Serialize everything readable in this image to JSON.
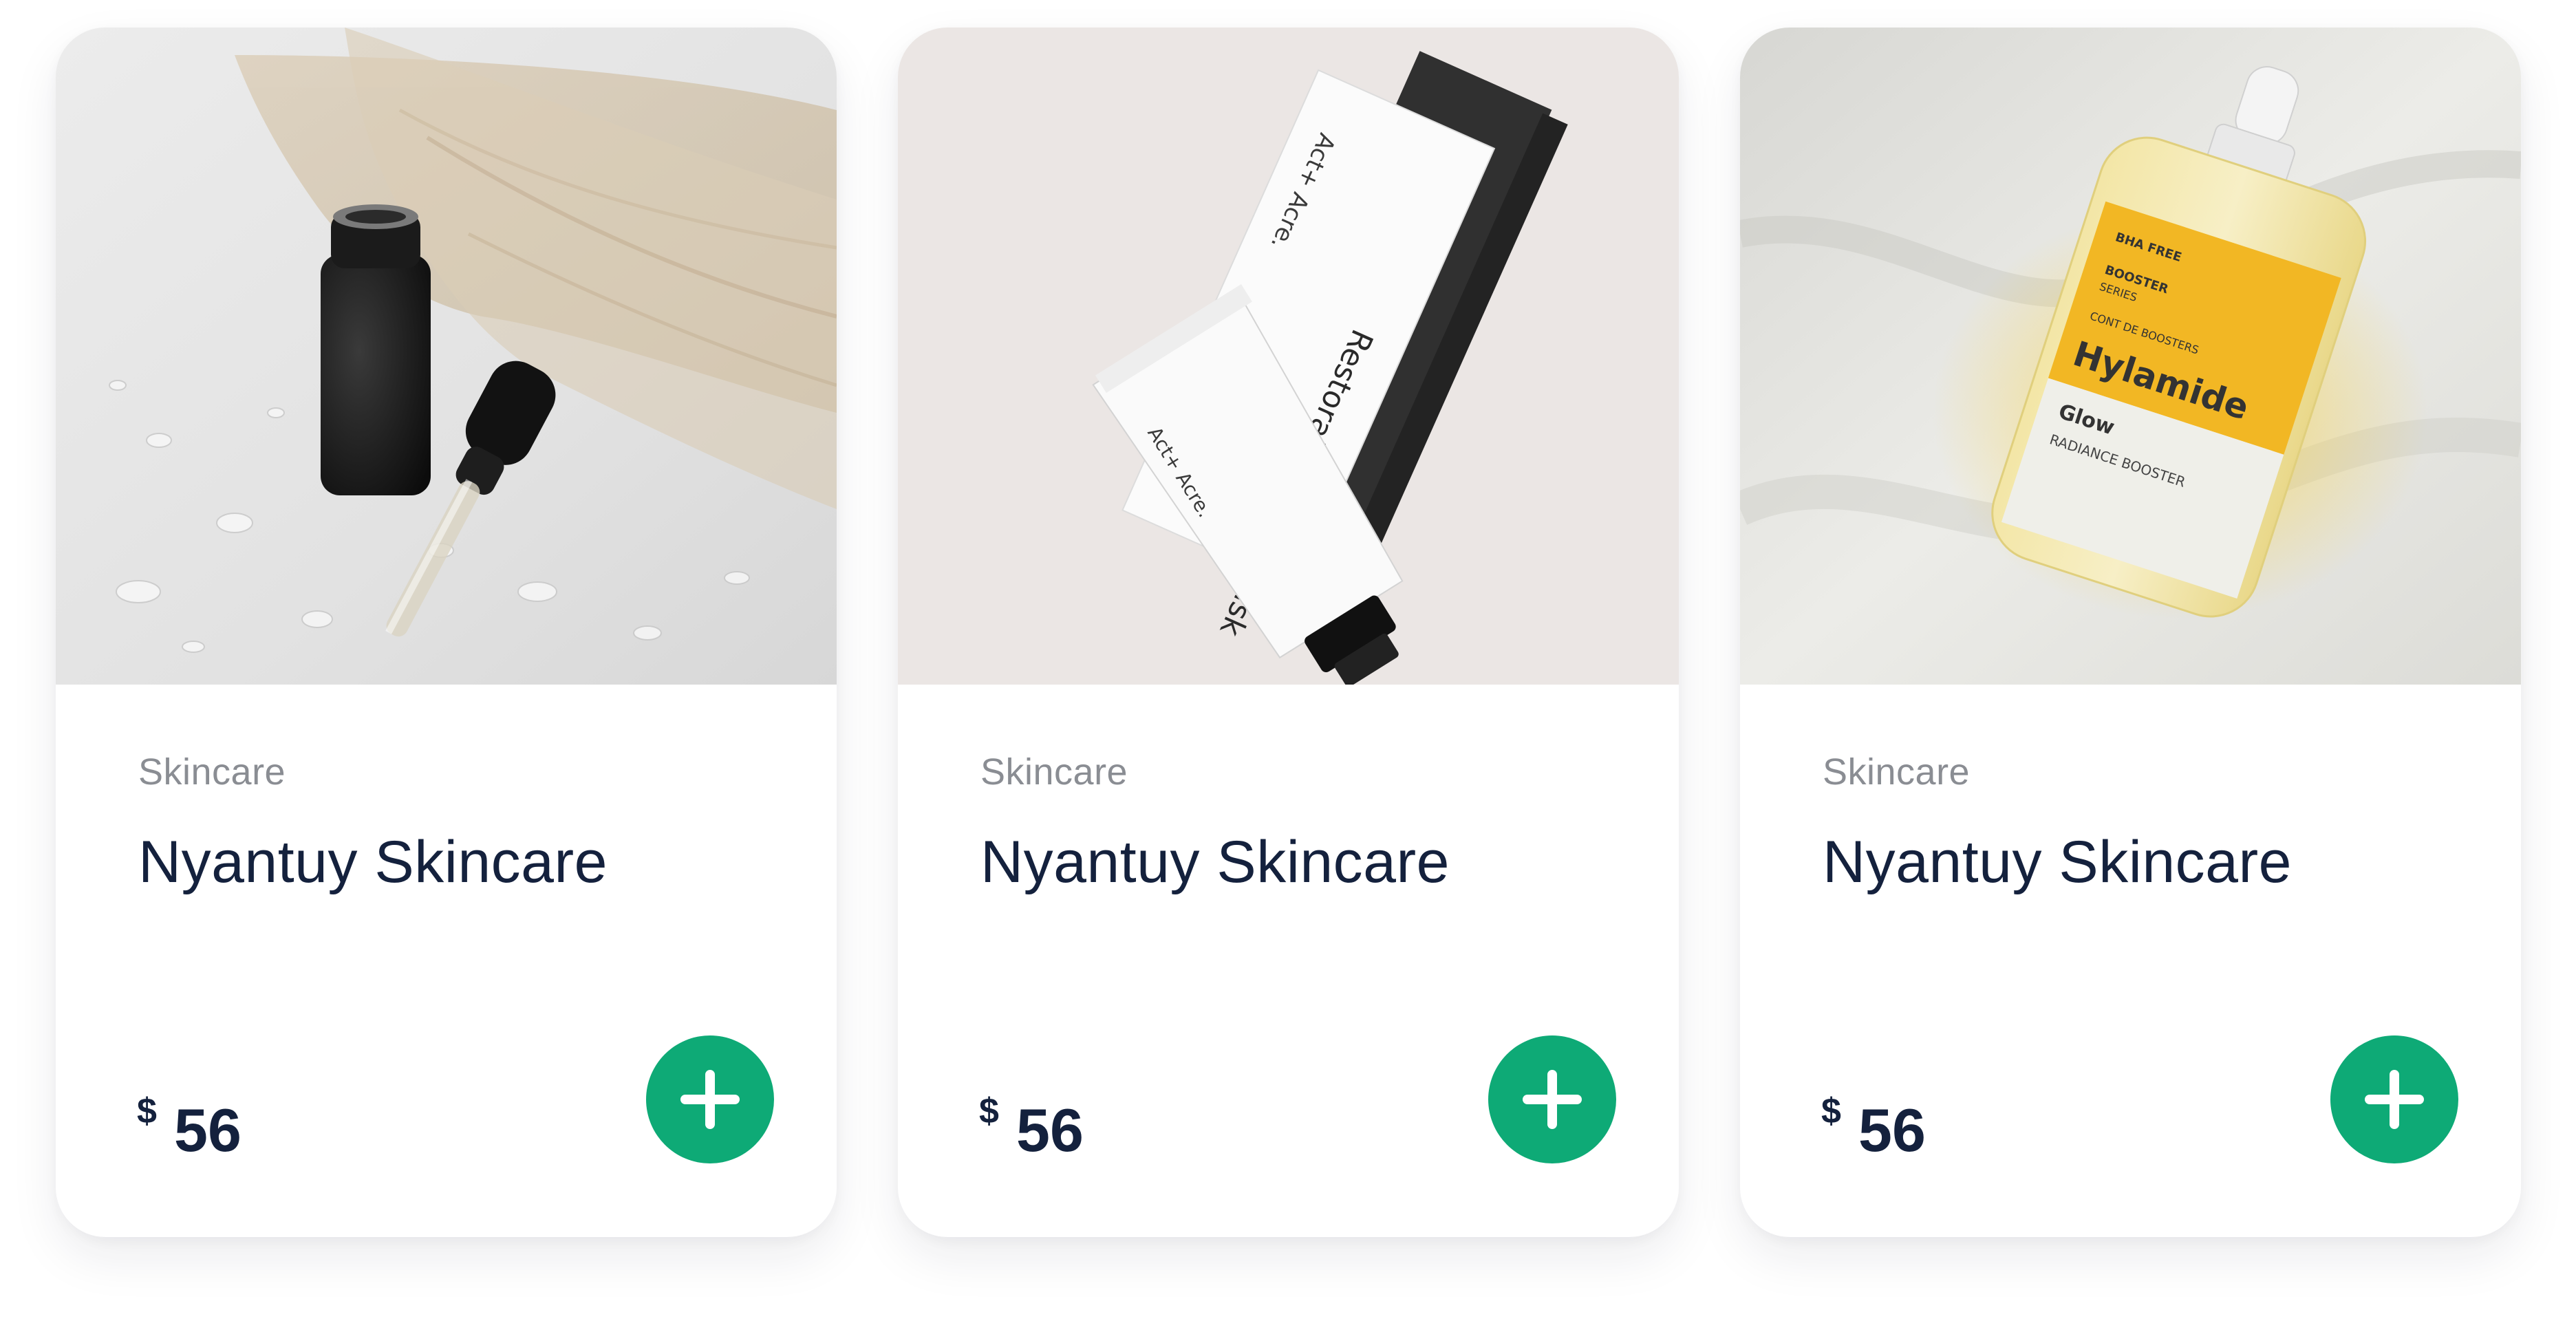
{
  "accent_color": "#0eaa76",
  "products": [
    {
      "category": "Skincare",
      "name": "Nyantuy Skincare",
      "currency": "$",
      "price": "56",
      "image": "dropper-bottle-with-pampas-grass"
    },
    {
      "category": "Skincare",
      "name": "Nyantuy Skincare",
      "currency": "$",
      "price": "56",
      "image": "act-acre-hair-mask-tube-and-box",
      "packaging": {
        "brand": "Act+ Acre.",
        "product": "Restorative Hair Mask"
      }
    },
    {
      "category": "Skincare",
      "name": "Nyantuy Skincare",
      "currency": "$",
      "price": "56",
      "image": "hylamide-serum-bottle-on-fabric",
      "packaging": {
        "tag1": "BHA FREE",
        "tag2": "BOOSTER",
        "tag2b": "SERIES",
        "line": "CONT DE BOOSTERS",
        "brand": "Hylamide",
        "product": "Glow",
        "descriptor": "RADIANCE BOOSTER"
      }
    }
  ],
  "icons": {
    "add": "plus-icon"
  }
}
